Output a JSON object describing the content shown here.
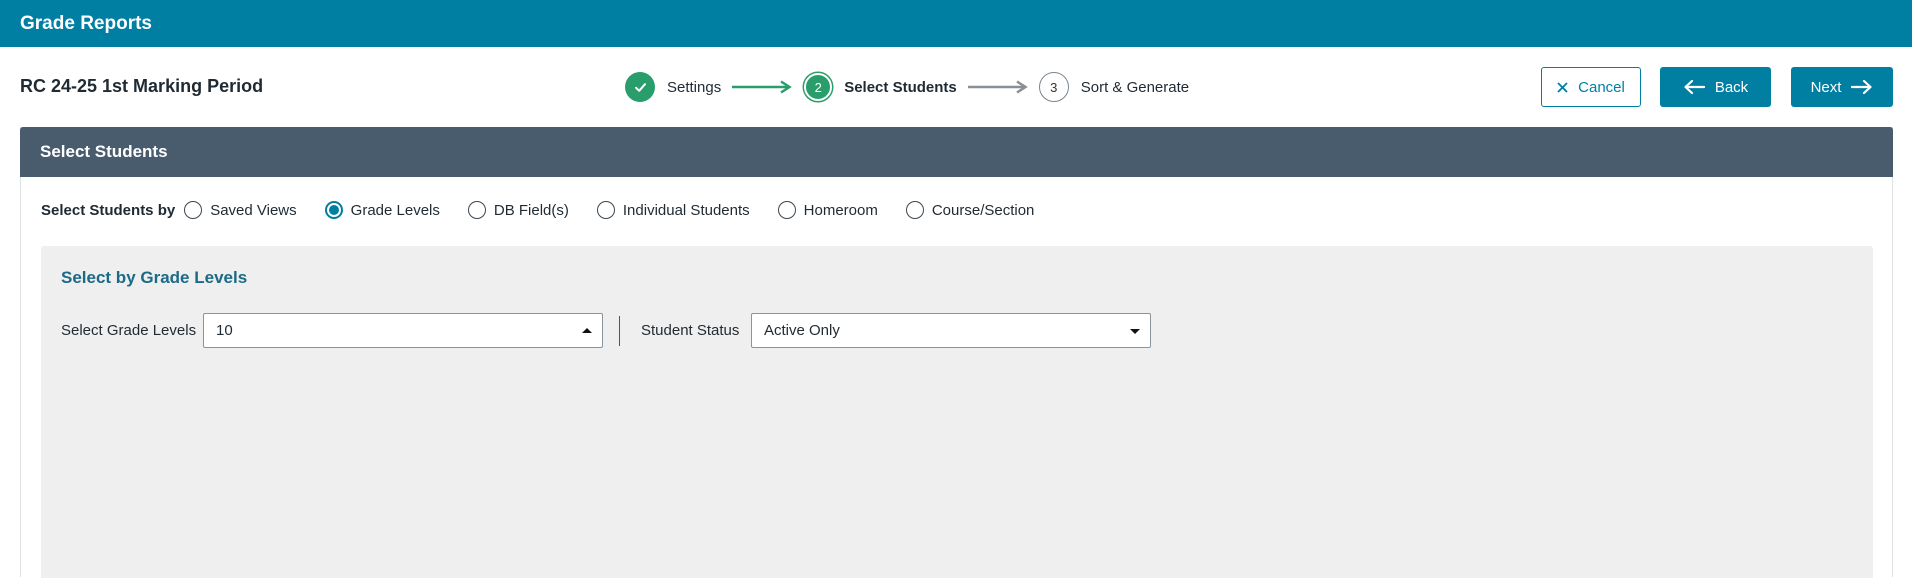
{
  "appbar": {
    "title": "Grade Reports"
  },
  "header": {
    "page_title": "RC 24-25 1st Marking Period",
    "steps": [
      {
        "number": "",
        "label": "Settings",
        "state": "done"
      },
      {
        "number": "2",
        "label": "Select Students",
        "state": "current"
      },
      {
        "number": "3",
        "label": "Sort & Generate",
        "state": "todo"
      }
    ],
    "buttons": {
      "cancel": "Cancel",
      "back": "Back",
      "next": "Next"
    }
  },
  "panel": {
    "title": "Select Students",
    "select_by_label": "Select Students by",
    "options": [
      "Saved Views",
      "Grade Levels",
      "DB Field(s)",
      "Individual Students",
      "Homeroom",
      "Course/Section"
    ],
    "selected_option": "Grade Levels",
    "grade_levels": {
      "title": "Select by Grade Levels",
      "grade_label": "Select Grade Levels",
      "grade_value": "10",
      "status_label": "Student Status",
      "status_value": "Active Only"
    }
  },
  "colors": {
    "brand": "#007fa3",
    "success": "#2a9d6c",
    "panel_header": "#485c6d",
    "subpanel": "#efefef"
  },
  "icons": {
    "step_done": "check-icon",
    "cancel": "close-icon",
    "back": "arrow-left-icon",
    "next": "arrow-right-icon"
  }
}
